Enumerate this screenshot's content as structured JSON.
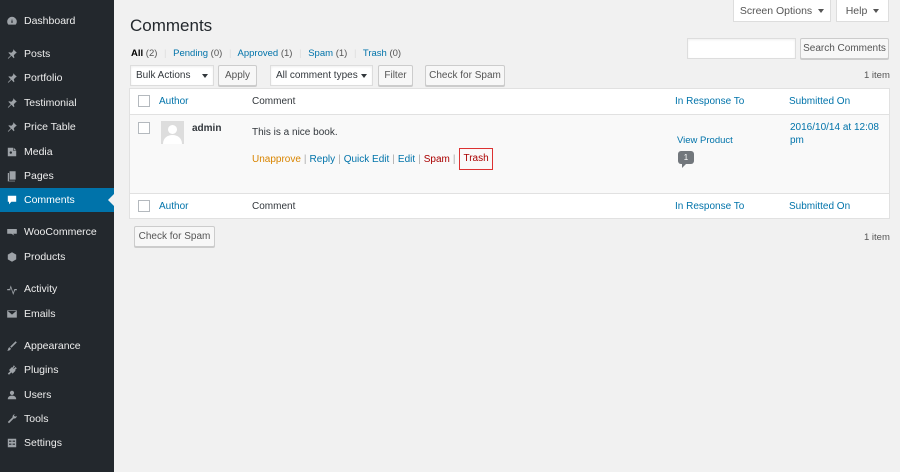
{
  "sidebar": {
    "items": [
      {
        "label": "Dashboard",
        "icon": "dashboard-icon"
      },
      {
        "label": "Posts",
        "icon": "pin-icon"
      },
      {
        "label": "Portfolio",
        "icon": "pin-icon"
      },
      {
        "label": "Testimonial",
        "icon": "pin-icon"
      },
      {
        "label": "Price Table",
        "icon": "pin-icon"
      },
      {
        "label": "Media",
        "icon": "media-icon"
      },
      {
        "label": "Pages",
        "icon": "pages-icon"
      },
      {
        "label": "Comments",
        "icon": "comment-icon",
        "active": true
      },
      {
        "label": "WooCommerce",
        "icon": "woocommerce-icon"
      },
      {
        "label": "Products",
        "icon": "products-icon"
      },
      {
        "label": "Activity",
        "icon": "activity-icon"
      },
      {
        "label": "Emails",
        "icon": "email-icon"
      },
      {
        "label": "Appearance",
        "icon": "brush-icon"
      },
      {
        "label": "Plugins",
        "icon": "plugin-icon"
      },
      {
        "label": "Users",
        "icon": "users-icon"
      },
      {
        "label": "Tools",
        "icon": "wrench-icon"
      },
      {
        "label": "Settings",
        "icon": "settings-icon"
      }
    ]
  },
  "screen_options": {
    "label": "Screen Options"
  },
  "help": {
    "label": "Help"
  },
  "page": {
    "title": "Comments"
  },
  "filters": {
    "all": {
      "label": "All",
      "count": "(2)"
    },
    "pending": {
      "label": "Pending",
      "count": "(0)"
    },
    "approved": {
      "label": "Approved",
      "count": "(1)"
    },
    "spam": {
      "label": "Spam",
      "count": "(1)"
    },
    "trash": {
      "label": "Trash",
      "count": "(0)"
    },
    "separator": "|"
  },
  "search": {
    "button_label": "Search Comments",
    "value": ""
  },
  "toolbar": {
    "bulk_actions": "Bulk Actions",
    "apply": "Apply",
    "comment_types": "All comment types",
    "filter": "Filter",
    "check_spam": "Check for Spam",
    "items_count": "1 item"
  },
  "table": {
    "columns": {
      "author": "Author",
      "comment": "Comment",
      "response": "In Response To",
      "submitted": "Submitted On"
    },
    "rows": [
      {
        "author": "admin",
        "comment": "This is a nice book.",
        "actions": {
          "unapprove": "Unapprove",
          "reply": "Reply",
          "quick_edit": "Quick Edit",
          "edit": "Edit",
          "spam": "Spam",
          "trash": "Trash",
          "separator": "|"
        },
        "response": "View Product",
        "response_count": "1",
        "submitted": "2016/10/14 at 12:08 pm"
      }
    ]
  },
  "bottom": {
    "check_spam": "Check for Spam",
    "items_count": "1 item"
  },
  "colors": {
    "sidebar_bg": "#23282d",
    "active_bg": "#0073aa",
    "link": "#0073aa",
    "unapprove": "#d98500",
    "spam": "#aa0000",
    "trash_outline": "#dc3232"
  }
}
